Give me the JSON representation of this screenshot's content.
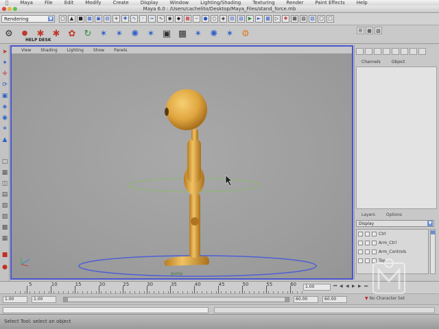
{
  "menubar": {
    "app": "Maya",
    "items": [
      "File",
      "Edit",
      "Modify",
      "Create",
      "Display",
      "Window",
      "Lighting/Shading",
      "Texturing",
      "Render",
      "Paint Effects",
      "Help"
    ],
    "clock": ""
  },
  "window": {
    "title": "Maya 6.0 : /Users/cachelito/Desktop/Maya_Files/stand_force.mb"
  },
  "statusline": {
    "mode": "Rendering"
  },
  "shelf": {
    "help_label": "HELP DESK"
  },
  "panel": {
    "menu": [
      "View",
      "Shading",
      "Lighting",
      "Show",
      "Panels"
    ],
    "object_label": "pump"
  },
  "sidepanel": {
    "tabs": [
      "Channels",
      "Object"
    ],
    "layers_tabs": [
      "Layers",
      "Options"
    ],
    "layer_mode": "Display",
    "layers": [
      "Ctrl",
      "Arm_Ctrl",
      "Arm_Controls",
      "Top"
    ]
  },
  "timeslider": {
    "ticks": [
      "5",
      "10",
      "15",
      "20",
      "25",
      "30",
      "35",
      "40",
      "45",
      "50",
      "55",
      "60"
    ],
    "current_frame": "1.00"
  },
  "rangeslider": {
    "start": "1.00",
    "inner_start": "1.00",
    "inner_end": "60.00",
    "end": "60.00",
    "autokey": "No Character Set"
  },
  "helpline": {
    "text": "Select Tool: select an object"
  },
  "colors": {
    "panel_border": "#4a55cf",
    "character": "#e0a640",
    "ground_ring": "#4d5fd6",
    "control_curve": "#7fc44a"
  }
}
